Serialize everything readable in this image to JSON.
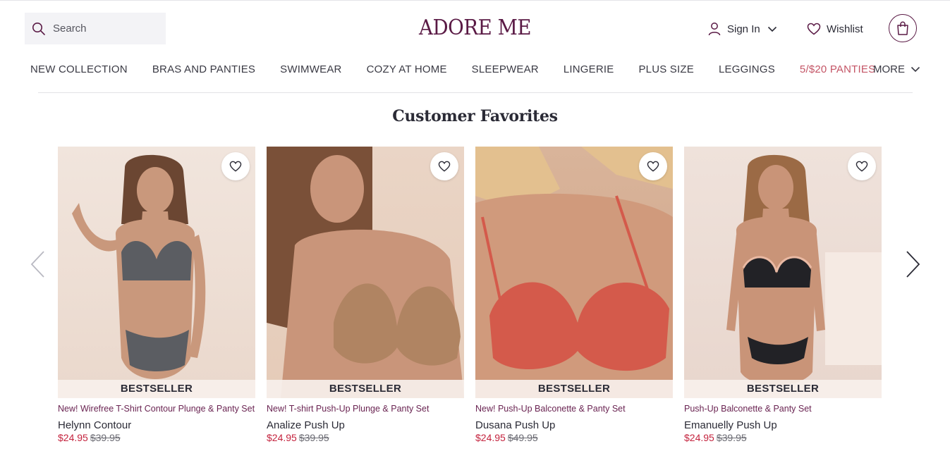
{
  "header": {
    "search_placeholder": "Search",
    "logo": "ADORE ME",
    "signin_label": "Sign In",
    "wishlist_label": "Wishlist"
  },
  "nav": {
    "items": [
      {
        "label": "NEW COLLECTION"
      },
      {
        "label": "BRAS AND PANTIES"
      },
      {
        "label": "SWIMWEAR"
      },
      {
        "label": "COZY AT HOME"
      },
      {
        "label": "SLEEPWEAR"
      },
      {
        "label": "LINGERIE"
      },
      {
        "label": "PLUS SIZE"
      },
      {
        "label": "LEGGINGS"
      },
      {
        "label": "5/$20 PANTIES"
      }
    ],
    "more_label": "MORE"
  },
  "section": {
    "title": "Customer Favorites"
  },
  "products": [
    {
      "badge": "BESTSELLER",
      "subtitle": "New! Wirefree T-Shirt Contour Plunge & Panty Set",
      "name": "Helynn Contour",
      "price": "$24.95",
      "was": "$39.95",
      "image": "model-gray-wirefree-set"
    },
    {
      "badge": "BESTSELLER",
      "subtitle": "New! T-shirt Push-Up Plunge & Panty Set",
      "name": "Analize Push Up",
      "price": "$24.95",
      "was": "$39.95",
      "image": "model-nude-pushup-bra"
    },
    {
      "badge": "BESTSELLER",
      "subtitle": "New! Push-Up Balconette & Panty Set",
      "name": "Dusana Push Up",
      "price": "$24.95",
      "was": "$49.95",
      "image": "model-coral-lace-balconette"
    },
    {
      "badge": "BESTSELLER",
      "subtitle": "Push-Up Balconette & Panty Set",
      "name": "Emanuelly Push Up",
      "price": "$24.95",
      "was": "$39.95",
      "image": "model-black-lace-set"
    }
  ],
  "colors": {
    "brand": "#5a1a45",
    "sale_nav": "#c45566",
    "price": "#c4233e"
  }
}
